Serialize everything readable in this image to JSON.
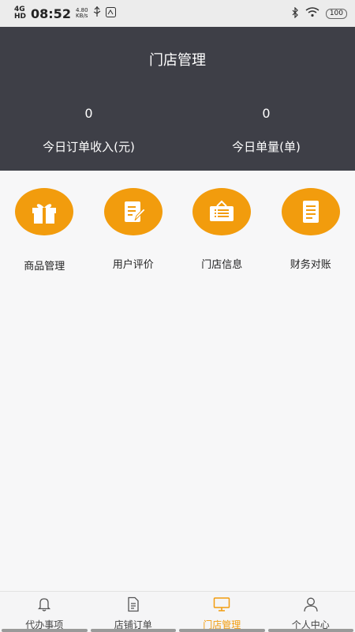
{
  "status_bar": {
    "network": "4G",
    "network_sub": "HD",
    "time": "08:52",
    "speed_value": "4.80",
    "speed_unit": "KB/s",
    "battery": "100"
  },
  "header": {
    "title": "门店管理",
    "stats": [
      {
        "value": "0",
        "label": "今日订单收入(元)"
      },
      {
        "value": "0",
        "label": "今日单量(单)"
      }
    ]
  },
  "menu": [
    {
      "label": "商品管理",
      "icon": "gift-icon"
    },
    {
      "label": "用户评价",
      "icon": "edit-note-icon"
    },
    {
      "label": "门店信息",
      "icon": "signboard-icon"
    },
    {
      "label": "财务对账",
      "icon": "document-icon"
    }
  ],
  "tabbar": [
    {
      "label": "代办事项",
      "icon": "bell-icon",
      "active": false
    },
    {
      "label": "店铺订单",
      "icon": "order-doc-icon",
      "active": false
    },
    {
      "label": "门店管理",
      "icon": "monitor-icon",
      "active": true
    },
    {
      "label": "个人中心",
      "icon": "person-icon",
      "active": false
    }
  ],
  "colors": {
    "accent": "#f29c0d",
    "header_bg": "#3e3f47",
    "page_bg": "#f7f7f8"
  }
}
